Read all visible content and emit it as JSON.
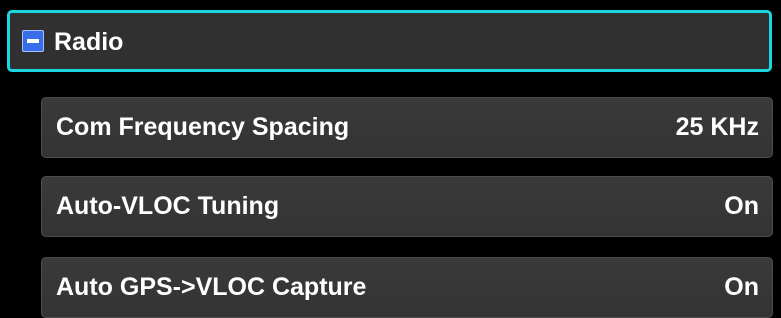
{
  "section": {
    "title": "Radio",
    "icon": "collapse-minus-icon",
    "expanded": true
  },
  "settings": [
    {
      "label": "Com Frequency Spacing",
      "value": "25 KHz"
    },
    {
      "label": "Auto-VLOC Tuning",
      "value": "On"
    },
    {
      "label": "Auto GPS->VLOC Capture",
      "value": "On"
    }
  ],
  "colors": {
    "background": "#000000",
    "row_background": "#353535",
    "focus_border": "#19d6e0",
    "icon_blue": "#3a6ee8",
    "text": "#ffffff"
  }
}
